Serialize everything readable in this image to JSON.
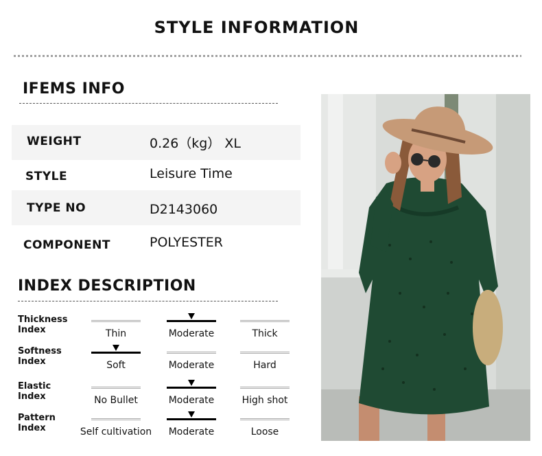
{
  "header": {
    "title": "STYLE INFORMATION"
  },
  "items_info": {
    "heading": "IFEMS INFO",
    "rows": [
      {
        "label": "WEIGHT",
        "value": "0.26（kg） XL"
      },
      {
        "label": "STYLE",
        "value": "Leisure Time"
      },
      {
        "label": "TYPE NO",
        "value": "D2143060"
      },
      {
        "label": "COMPONENT",
        "value": "POLYESTER"
      }
    ]
  },
  "index_description": {
    "heading": "INDEX DESCRIPTION",
    "indices": [
      {
        "label_line1": "Thickness",
        "label_line2": "Index",
        "options": [
          "Thin",
          "Moderate",
          "Thick"
        ],
        "selected": 1
      },
      {
        "label_line1": "Softness",
        "label_line2": "Index",
        "options": [
          "Soft",
          "Moderate",
          "Hard"
        ],
        "selected": 0
      },
      {
        "label_line1": "Elastic",
        "label_line2": "Index",
        "options": [
          "No Bullet",
          "Moderate",
          "High shot"
        ],
        "selected": 1
      },
      {
        "label_line1": "Pattern",
        "label_line2": "Index",
        "options": [
          "Self cultivation",
          "Moderate",
          "Loose"
        ],
        "selected": 1
      }
    ]
  },
  "colors": {
    "dress": "#1f4a33",
    "hat": "#c69a77",
    "bag": "#c8ad7c",
    "column": "#e3e5e3"
  }
}
